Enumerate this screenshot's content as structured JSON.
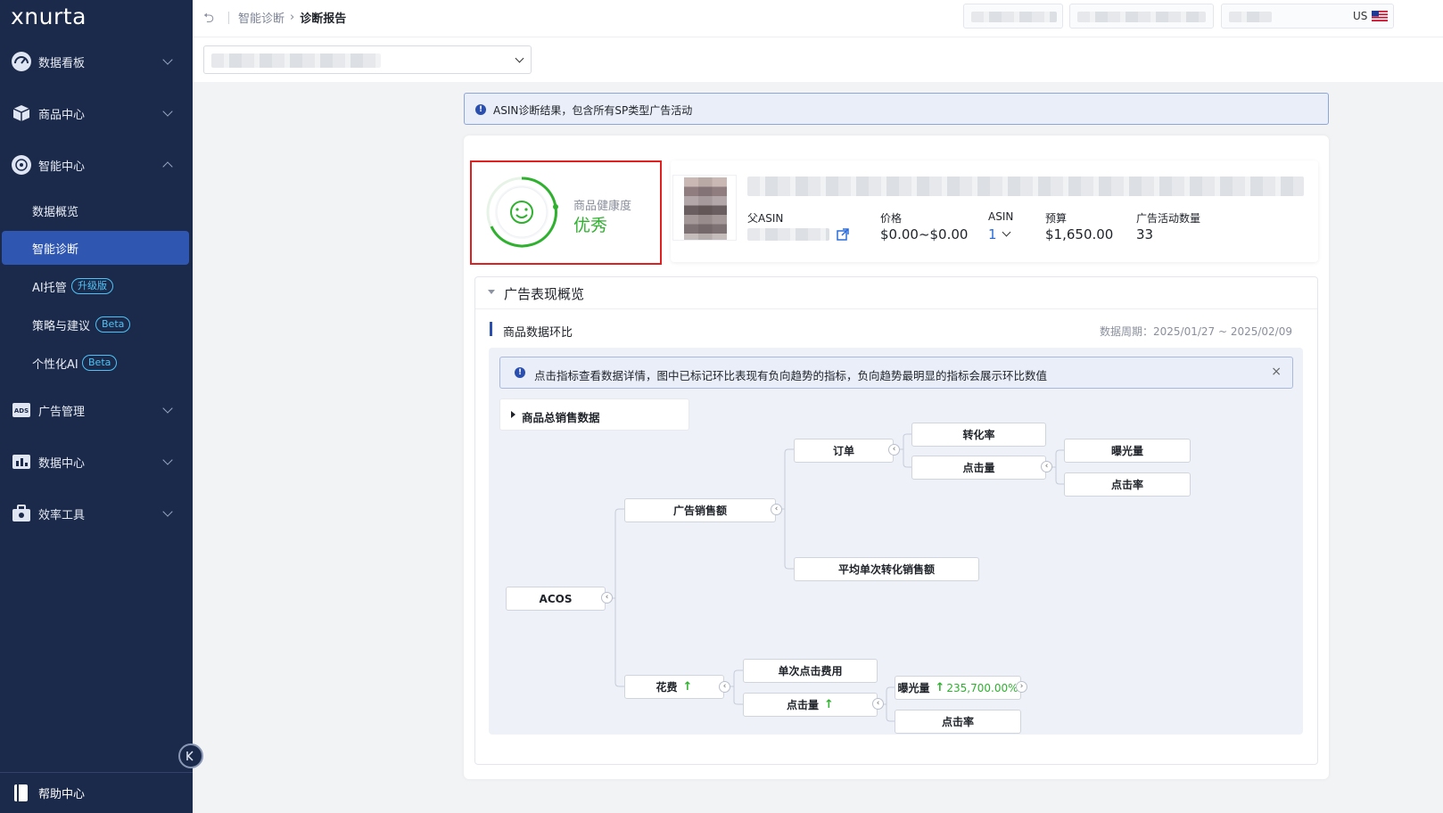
{
  "app": {
    "logo": "xnurta"
  },
  "sidebar": {
    "items": [
      {
        "label": "数据看板",
        "icon": "dashboard-icon"
      },
      {
        "label": "商品中心",
        "icon": "box-icon"
      },
      {
        "label": "智能中心",
        "icon": "brain-icon"
      },
      {
        "label": "广告管理",
        "icon": "ads-icon"
      },
      {
        "label": "数据中心",
        "icon": "chart-icon"
      },
      {
        "label": "效率工具",
        "icon": "toolbox-icon"
      }
    ],
    "sub_items": [
      {
        "label": "数据概览"
      },
      {
        "label": "智能诊断"
      },
      {
        "label": "AI托管",
        "tag": "升级版"
      },
      {
        "label": "策略与建议",
        "tag": "Beta"
      },
      {
        "label": "个性化AI",
        "tag": "Beta"
      }
    ],
    "help": "帮助中心"
  },
  "topbar": {
    "breadcrumb": [
      "智能诊断",
      "诊断报告"
    ],
    "region": "US"
  },
  "alert_top": "ASIN诊断结果，包含所有SP类型广告活动",
  "health": {
    "label": "商品健康度",
    "value": "优秀"
  },
  "product": {
    "parent_asin_label": "父ASIN",
    "price_label": "价格",
    "price_value": "$0.00~$0.00",
    "asin_label": "ASIN",
    "asin_value": "1",
    "budget_label": "预算",
    "budget_value": "$1,650.00",
    "campaigns_label": "广告活动数量",
    "campaigns_value": "33"
  },
  "performance": {
    "title": "广告表现概览",
    "section_title": "商品数据环比",
    "period": "数据周期：2025/01/27 ~ 2025/02/09",
    "alert": "点击指标查看数据详情，图中已标记环比表现有负向趋势的指标，负向趋势最明显的指标会展示环比数值",
    "close": "×",
    "sales_toggle": "商品总销售数据"
  },
  "tree": {
    "acos": "ACOS",
    "ad_sales": "广告销售额",
    "orders": "订单",
    "conversion": "转化率",
    "clicks_a": "点击量",
    "impressions_a": "曝光量",
    "ctr_a": "点击率",
    "avg_sales": "平均单次转化销售额",
    "spend": "花费",
    "cpc": "单次点击费用",
    "clicks_b": "点击量",
    "impressions_b": "曝光量",
    "impressions_b_change": "235,700.00%",
    "ctr_b": "点击率",
    "up_arrow": "↑"
  },
  "colors": {
    "sidebar": "#1b2a4a",
    "accent": "#2f56b0",
    "good": "#2fb12f",
    "highlight_border": "#e02020"
  }
}
